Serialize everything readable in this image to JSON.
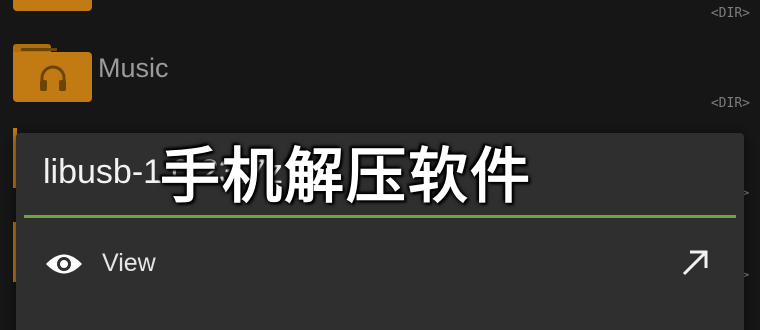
{
  "file_list": {
    "rows": [
      {
        "name": "",
        "tag": "<DIR>"
      },
      {
        "name": "Music",
        "tag": "<DIR>"
      }
    ],
    "peek_chevron": ">"
  },
  "dialog": {
    "title": "libusb-1.0.23.7z",
    "divider_color": "#6aa83a",
    "menu": [
      {
        "label": "View",
        "icon": "eye-icon",
        "action_icon": "arrow-up-right-icon"
      }
    ]
  },
  "watermark": {
    "text": "手机解压软件"
  },
  "colors": {
    "background": "#161616",
    "folder": "#c27b12",
    "dialog": "#2f2f2f",
    "accent": "#6aa83a"
  }
}
